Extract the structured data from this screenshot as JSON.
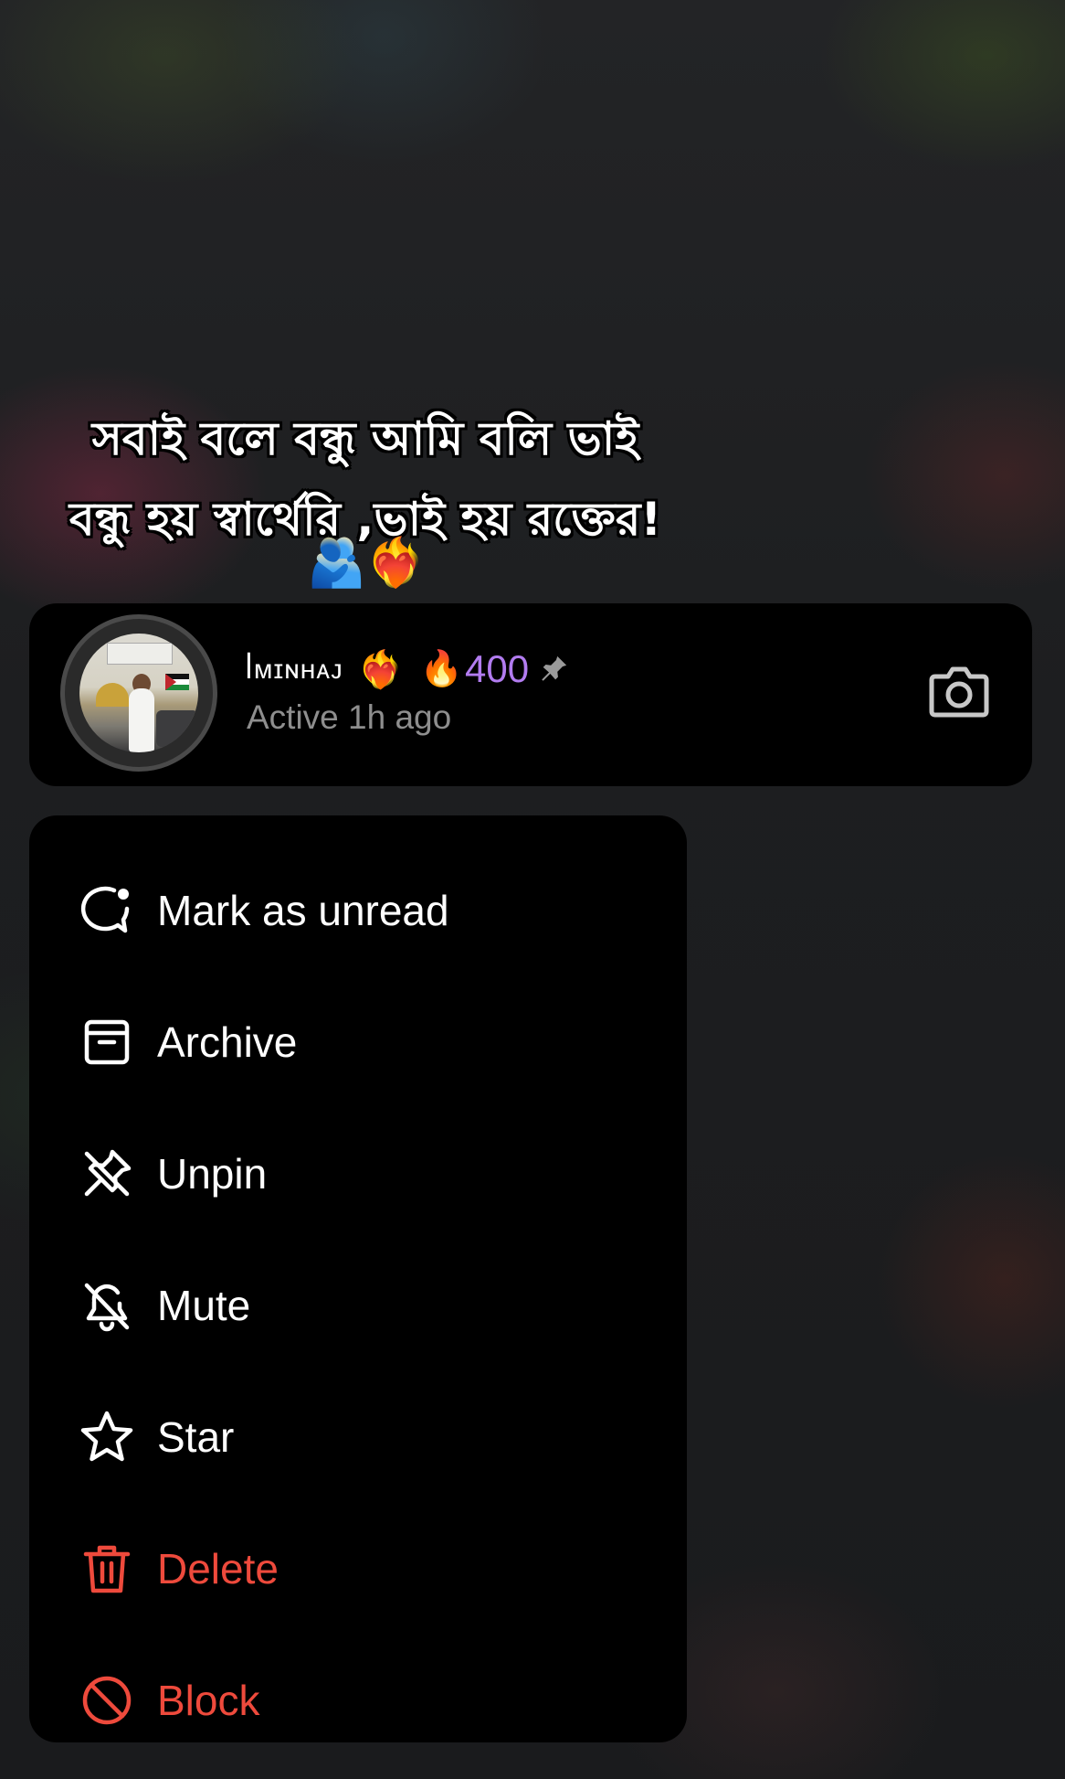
{
  "note": {
    "line1": "সবাই বলে বন্ধু আমি বলি ভাই",
    "line2": "বন্ধু হয় স্বার্থেরি ,ভাই হয় রক্তের!",
    "emoji": "🫂❤️‍🔥"
  },
  "header": {
    "name": "ꟾᴍɪɴʜᴀᴊ",
    "emoji_heart": "❤️‍🔥",
    "streak_icon": "🔥",
    "streak_count": "400",
    "status": "Active 1h ago",
    "streak_color": "#b27cf0"
  },
  "menu": {
    "items": [
      {
        "label": "Mark as unread",
        "icon": "unread-bubble-icon"
      },
      {
        "label": "Archive",
        "icon": "archive-box-icon"
      },
      {
        "label": "Unpin",
        "icon": "unpin-icon"
      },
      {
        "label": "Mute",
        "icon": "bell-off-icon"
      },
      {
        "label": "Star",
        "icon": "star-icon"
      },
      {
        "label": "Delete",
        "icon": "trash-icon"
      },
      {
        "label": "Block",
        "icon": "block-icon"
      }
    ],
    "danger_color": "#ee4a3c"
  }
}
